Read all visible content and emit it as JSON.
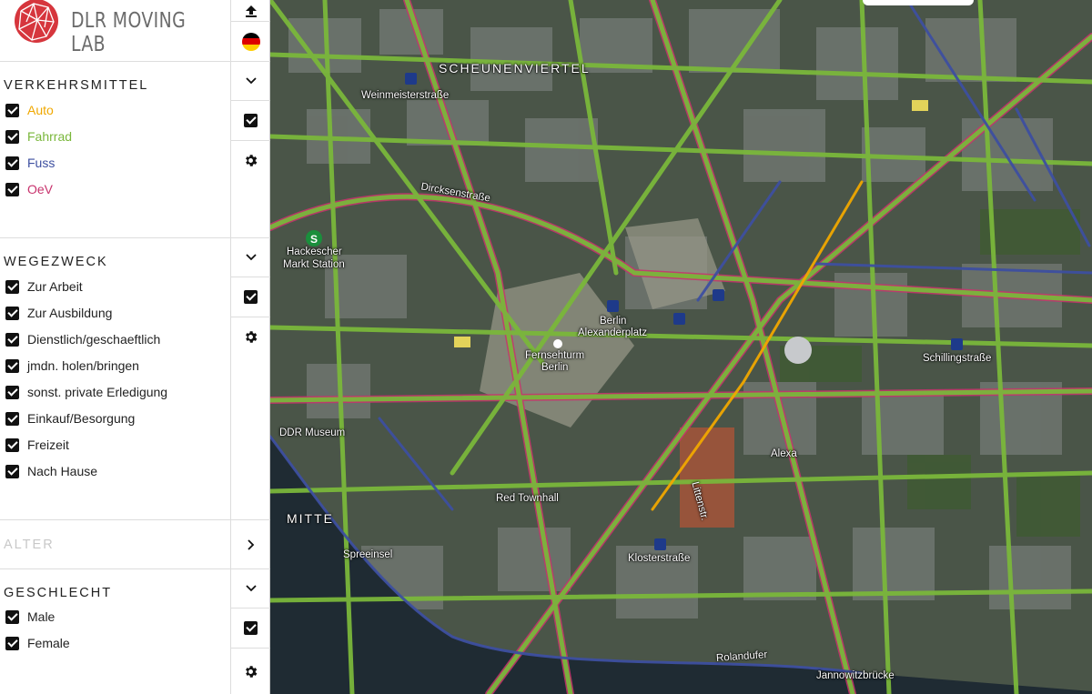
{
  "app": {
    "logo_text": "DLR MOVING LAB"
  },
  "colors": {
    "auto": "#f0a800",
    "fahrrad": "#7ab73b",
    "fuss": "#3d4fa0",
    "oev": "#c8336d",
    "muted": "#c8c8c8"
  },
  "sections": {
    "verkehrsmittel": {
      "title": "Verkehrsmittel",
      "items": [
        {
          "label": "Auto",
          "checked": true
        },
        {
          "label": "Fahrrad",
          "checked": true
        },
        {
          "label": "Fuss",
          "checked": true
        },
        {
          "label": "OeV",
          "checked": true
        }
      ]
    },
    "wegezweck": {
      "title": "Wegezweck",
      "items": [
        {
          "label": "Zur Arbeit",
          "checked": true
        },
        {
          "label": "Zur Ausbildung",
          "checked": true
        },
        {
          "label": "Dienstlich/geschaeftlich",
          "checked": true
        },
        {
          "label": "jmdn. holen/bringen",
          "checked": true
        },
        {
          "label": "sonst. private Erledigung",
          "checked": true
        },
        {
          "label": "Einkauf/Besorgung",
          "checked": true
        },
        {
          "label": "Freizeit",
          "checked": true
        },
        {
          "label": "Nach Hause",
          "checked": true
        }
      ]
    },
    "alter": {
      "title": "Alter"
    },
    "geschlecht": {
      "title": "Geschlecht",
      "items": [
        {
          "label": "Male",
          "checked": true
        },
        {
          "label": "Female",
          "checked": true
        }
      ]
    }
  },
  "map": {
    "labels": {
      "scheunenviertel": "SCHEUNENVIERTEL",
      "mitte": "MITTE",
      "weinmeisterstrasse": "Weinmeisterstraße",
      "hackescher": "Hackescher",
      "markt_station": "Markt Station",
      "berlin_alexanderplatz_1": "Berlin",
      "berlin_alexanderplatz_2": "Alexanderplatz",
      "fernsehturm_1": "Fernsehturm",
      "fernsehturm_2": "Berlin",
      "ddr_museum": "DDR Museum",
      "alexa": "Alexa",
      "red_townhall": "Red Townhall",
      "klosterstrasse": "Klosterstraße",
      "schillingstrasse": "Schillingstraße",
      "jannowitzbruecke": "Jannowitzbrücke",
      "spreeinsel": "Spreeinsel",
      "dircksenstrasse": "Dircksenstraße",
      "rolandufer": "Rolandufer",
      "littenstrasse": "Littenstr."
    }
  }
}
